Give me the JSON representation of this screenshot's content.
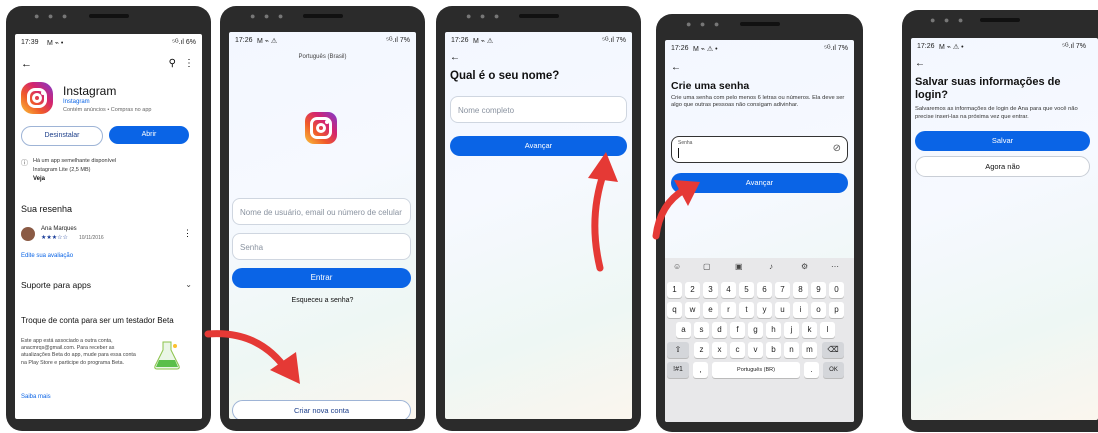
{
  "phone1": {
    "status_time": "17:39",
    "status_icons": "M ⌁ •",
    "status_right": "⁵ᴳ.ıl 6%",
    "app_name": "Instagram",
    "developer": "Instagram",
    "meta": "Contém anúncios • Compras no app",
    "uninstall_label": "Desinstalar",
    "open_label": "Abrir",
    "similar_text_1": "Há um app semelhante disponível",
    "similar_text_2": "Instagram Lite (2,5 MB)",
    "similar_link": "Veja",
    "review_header": "Sua resenha",
    "reviewer_name": "Ana Marques",
    "review_stars": "★★★☆☆",
    "review_date": "10/11/2016",
    "edit_review": "Edite sua avaliação",
    "support_label": "Suporte para apps",
    "beta_title": "Troque de conta para ser um testador Beta",
    "beta_text": "Este app está associado a outra conta, anacmrqs@gmail.com. Para receber as atualizações Beta do app, mude para essa conta na Play Store e participe do programa Beta.",
    "learn_more": "Saiba mais"
  },
  "phone2": {
    "status_time": "17:26",
    "status_right": "⁵ᴳ.ıl 7%",
    "language": "Português (Brasil)",
    "username_placeholder": "Nome de usuário, email ou número de celular",
    "password_placeholder": "Senha",
    "login_label": "Entrar",
    "forgot_label": "Esqueceu a senha?",
    "create_label": "Criar nova conta"
  },
  "phone3": {
    "status_time": "17:26",
    "status_right": "⁵ᴳ.ıl 7%",
    "title": "Qual é o seu nome?",
    "name_placeholder": "Nome completo",
    "next_label": "Avançar"
  },
  "phone4": {
    "status_time": "17:26",
    "status_right": "⁵ᴳ.ıl 7%",
    "title": "Crie uma senha",
    "desc": "Crie uma senha com pelo menos 6 letras ou números. Ela deve ser algo que outras pessoas não consigam adivinhar.",
    "password_label": "Senha",
    "next_label": "Avançar",
    "keyboard": {
      "row1": [
        "1",
        "2",
        "3",
        "4",
        "5",
        "6",
        "7",
        "8",
        "9",
        "0"
      ],
      "row2": [
        "q",
        "w",
        "e",
        "r",
        "t",
        "y",
        "u",
        "i",
        "o",
        "p"
      ],
      "row3": [
        "a",
        "s",
        "d",
        "f",
        "g",
        "h",
        "j",
        "k",
        "l"
      ],
      "row4": [
        "z",
        "x",
        "c",
        "v",
        "b",
        "n",
        "m"
      ],
      "sym_key": "!#1",
      "comma_key": ",",
      "space_key": "Português (BR)",
      "period_key": ".",
      "ok_key": "OK",
      "shift_key": "⇧",
      "backspace_key": "⌫"
    }
  },
  "phone5": {
    "status_time": "17:26",
    "status_right": "⁵ᴳ.ıl 7%",
    "title": "Salvar suas informações de login?",
    "desc": "Salvaremos as informações de login de Ana para que você não precise inseri-las na próxima vez que entrar.",
    "save_label": "Salvar",
    "not_now_label": "Agora não"
  },
  "colors": {
    "accent_blue": "#0a64e6",
    "arrow_red": "#e53935"
  }
}
